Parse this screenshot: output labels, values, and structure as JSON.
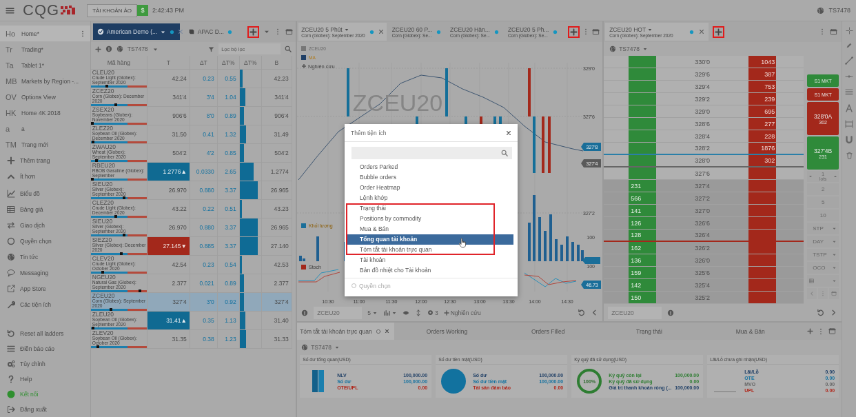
{
  "top_bar": {
    "logo": "CQG",
    "account_button": "TÀI KHOẢN ẢO",
    "currency_badge": "$",
    "time": "2:42:43 PM",
    "account": "TS7478"
  },
  "sidebar": {
    "pages": [
      {
        "abbr": "Ho",
        "label": "Home*",
        "selected": true
      },
      {
        "abbr": "Tr",
        "label": "Trading*",
        "selected": false
      },
      {
        "abbr": "Ta",
        "label": "Tablet 1*",
        "selected": false
      },
      {
        "abbr": "MB",
        "label": "Markets by Region -...",
        "selected": false
      },
      {
        "abbr": "OV",
        "label": "Options View",
        "selected": false
      },
      {
        "abbr": "HK",
        "label": "Home 4K 2018",
        "selected": false
      },
      {
        "abbr": "a",
        "label": "a",
        "selected": false
      },
      {
        "abbr": "TM",
        "label": "Trang mới",
        "selected": false
      }
    ],
    "page_actions": [
      {
        "kind": "plus",
        "label": "Thêm trang"
      },
      {
        "kind": "chevron",
        "label": "Ít hơn"
      }
    ],
    "nav": [
      {
        "kind": "chart",
        "label": "Biểu đồ"
      },
      {
        "kind": "table",
        "label": "Bảng giá"
      },
      {
        "kind": "swap",
        "label": "Giao dịch"
      },
      {
        "kind": "ring",
        "label": "Quyền chọn"
      },
      {
        "kind": "globe",
        "label": "Tin tức"
      },
      {
        "kind": "speech",
        "label": "Messaging"
      },
      {
        "kind": "external",
        "label": "App Store"
      },
      {
        "kind": "wrench",
        "label": "Các tiện ích"
      }
    ],
    "footer": [
      {
        "kind": "reset",
        "label": "Reset all ladders"
      },
      {
        "kind": "list",
        "label": "Điền báo cáo"
      },
      {
        "kind": "gears",
        "label": "Tùy chỉnh"
      },
      {
        "kind": "help",
        "label": "Help"
      },
      {
        "kind": "status",
        "label": "Kết nối",
        "connected": true
      },
      {
        "kind": "logout",
        "label": "Đăng xuất"
      }
    ]
  },
  "quote_panel": {
    "tabs": [
      {
        "label": "American Demo (...",
        "selected": true
      },
      {
        "label": "APAC D...",
        "selected": false
      }
    ],
    "account": "TS7478",
    "filter_placeholder": "Lọc bộ lọc",
    "columns": [
      "Mã hàng",
      "T",
      "ΔT",
      "ΔT%",
      "ΔT%",
      "B"
    ],
    "rows": [
      {
        "symbol": "CLEU20",
        "description": "Crude Light (Globex): September 2020",
        "range": {
          "level": 0.28
        },
        "last": "42.24",
        "kind": "plain",
        "change": "0.23",
        "change_pct": "0.55",
        "level": 0.12,
        "bid": "42.23",
        "selected": false
      },
      {
        "symbol": "ZCEZ20",
        "description": "Corn (Globex): December 2020",
        "range": {
          "level": 0.45
        },
        "last": "341'4",
        "kind": "plain",
        "change": "3'4",
        "change_pct": "1.04",
        "level": 0.25,
        "bid": "341'4",
        "selected": false
      },
      {
        "symbol": "ZSEX20",
        "description": "Soybeans (Globex): November 2020",
        "range": {
          "level": 0.0
        },
        "last": "906'6",
        "kind": "plain",
        "change": "8'0",
        "change_pct": "0.89",
        "level": 0.2,
        "bid": "906'4",
        "selected": false
      },
      {
        "symbol": "ZLEZ20",
        "description": "Soybean Oil (Globex): December 2020",
        "range": {
          "level": 0.02
        },
        "last": "31.50",
        "kind": "plain",
        "change": "0.41",
        "change_pct": "1.32",
        "level": 0.3,
        "bid": "31.49",
        "selected": false
      },
      {
        "symbol": "ZWAU20",
        "description": "Wheat (Globex): September 2020",
        "range": {
          "level": 0.08
        },
        "last": "504'2",
        "kind": "plain",
        "change": "4'2",
        "change_pct": "0.85",
        "level": 0.2,
        "bid": "504'2",
        "selected": false
      },
      {
        "symbol": "RBEU20",
        "description": "RBOB Gasoline (Globex): September",
        "range": {
          "level": 0.0
        },
        "last": "1.2776▲",
        "kind": "up",
        "change": "0.0330",
        "change_pct": "2.65",
        "level": 0.65,
        "bid": "1.2774",
        "selected": false
      },
      {
        "symbol": "SIEU20",
        "description": "Silver (Globex): September 2020",
        "range": {
          "level": 0.6
        },
        "last": "26.970",
        "kind": "plain",
        "change": "0.880",
        "change_pct": "3.37",
        "level": 0.85,
        "bid": "26.965",
        "selected": false
      },
      {
        "symbol": "CLEZ20",
        "description": "Crude Light (Globex): December 2020",
        "range": {
          "level": 0.45
        },
        "last": "43.22",
        "kind": "plain",
        "change": "0.22",
        "change_pct": "0.51",
        "level": 0.1,
        "bid": "43.23",
        "selected": false
      },
      {
        "symbol": "SIEU20",
        "description": "Silver (Globex): September 2020",
        "range": {
          "level": 0.6
        },
        "last": "26.970",
        "kind": "plain",
        "change": "0.880",
        "change_pct": "3.37",
        "level": 0.85,
        "bid": "26.965",
        "selected": false
      },
      {
        "symbol": "SIEZ20",
        "description": "Silver (Globex): December 2020",
        "range": {
          "level": 0.55
        },
        "last": "27.145▼",
        "kind": "down",
        "change": "0.885",
        "change_pct": "3.37",
        "level": 0.85,
        "bid": "27.140",
        "selected": false
      },
      {
        "symbol": "CLEV20",
        "description": "Crude Light (Globex): October 2020",
        "range": {
          "level": 0.2
        },
        "last": "42.54",
        "kind": "plain",
        "change": "0.23",
        "change_pct": "0.54",
        "level": 0.1,
        "bid": "42.53",
        "selected": false
      },
      {
        "symbol": "NGEU20",
        "description": "Natural Gas (Globex): September 2020",
        "range": {
          "level": 0.9
        },
        "last": "2.377",
        "kind": "plain",
        "change": "0.021",
        "change_pct": "0.89",
        "level": 0.2,
        "bid": "2.377",
        "selected": false
      },
      {
        "symbol": "ZCEU20",
        "description": "Corn (Globex): September 2020",
        "range": {
          "level": 0.35
        },
        "last": "327'4",
        "kind": "plain",
        "change": "3'0",
        "change_pct": "0.92",
        "level": 0.2,
        "bid": "327'4",
        "selected": true
      },
      {
        "symbol": "ZLEU20",
        "description": "Soybean Oil (Globex): September 2020",
        "range": {
          "level": 0.02
        },
        "last": "31.41▲",
        "kind": "up",
        "change": "0.35",
        "change_pct": "1.13",
        "level": 0.25,
        "bid": "31.40",
        "selected": false
      },
      {
        "symbol": "ZLEV20",
        "description": "Soybean Oil (Globex): October 2020",
        "range": {
          "level": 0.1
        },
        "last": "31.35",
        "kind": "plain",
        "change": "0.38",
        "change_pct": "1.23",
        "level": 0.28,
        "bid": "31.33",
        "selected": false
      }
    ]
  },
  "chart_panel": {
    "tabs": [
      {
        "title": "ZCEU20 5 Phút",
        "subtitle": "Corn (Globex): September 2020",
        "selected": true
      },
      {
        "title": "ZCEU20 60 P...",
        "subtitle": "Corn (Globex): Se...",
        "selected": false
      },
      {
        "title": "ZCEU20 Hàn...",
        "subtitle": "Corn (Globex): Se...",
        "selected": false
      },
      {
        "title": "ZCEU20 5 Ph...",
        "subtitle": "Corn (Globex): Se...",
        "selected": false
      }
    ],
    "watermark": "ZCEU20",
    "legend": [
      {
        "label": "ZCEU20",
        "color": "#777777"
      },
      {
        "label": "MA",
        "color": "#1f3f66"
      }
    ],
    "study_link": "Nghiên cứu",
    "price_labels": [
      "329'0",
      "327'6",
      "327'2"
    ],
    "price_badges": [
      {
        "text": "327'8",
        "color": "#1a6e99"
      },
      {
        "text": "327'4",
        "color": "#5a5a5a"
      }
    ],
    "volume_legend": {
      "label": "Khối lượng",
      "color": "#1a6e99"
    },
    "volume_label": "100",
    "stoch_legend": {
      "label": "Stoch",
      "color": "#a3281b"
    },
    "stoch_label": "100",
    "stoch_badge": "46.73",
    "time_labels": [
      "10:30",
      "11:00",
      "11:30",
      "12:00",
      "12:30",
      "13:00",
      "13:30",
      "14:00",
      "14:30"
    ],
    "toolbar": {
      "symbol": "ZCEU20",
      "interval": "5",
      "study_count": "3",
      "study_button": "Nghiên cứu"
    }
  },
  "dom_panel": {
    "tab": {
      "title": "ZCEU20 HOT",
      "subtitle": "Corn (Globex): September 2020",
      "selected": true
    },
    "account": "TS7478",
    "ladder": [
      {
        "price": "330'0",
        "ask": "1043",
        "shaded": false
      },
      {
        "price": "329'6",
        "ask": "387",
        "shaded": false
      },
      {
        "price": "329'4",
        "ask": "753",
        "shaded": false
      },
      {
        "price": "329'2",
        "ask": "239",
        "shaded": false
      },
      {
        "price": "329'0",
        "ask": "695",
        "shaded": false
      },
      {
        "price": "328'6",
        "ask": "277",
        "shaded": false
      },
      {
        "price": "328'4",
        "ask": "228",
        "shaded": false
      },
      {
        "price": "328'2",
        "ask": "1876",
        "shaded": false,
        "divider": {
          "color": "#2a7fa8"
        }
      },
      {
        "price": "328'0",
        "ask": "302",
        "shaded": false,
        "divider": {
          "color": "#666666"
        }
      },
      {
        "price": "327'6",
        "shaded": false
      },
      {
        "price": "327'4",
        "bid": "231",
        "shaded": true
      },
      {
        "price": "327'2",
        "bid": "566",
        "shaded": true
      },
      {
        "price": "327'0",
        "bid": "141",
        "shaded": true
      },
      {
        "price": "326'6",
        "bid": "126",
        "shaded": true
      },
      {
        "price": "326'4",
        "bid": "128",
        "shaded": true,
        "divider": {
          "color": "#a3281b"
        }
      },
      {
        "price": "326'2",
        "bid": "162",
        "shaded": true
      },
      {
        "price": "326'0",
        "bid": "136",
        "shaded": true
      },
      {
        "price": "325'6",
        "bid": "159",
        "shaded": true
      },
      {
        "price": "325'4",
        "bid": "142",
        "shaded": true
      },
      {
        "price": "325'2",
        "bid": "150",
        "shaded": true
      }
    ],
    "order_buttons": [
      {
        "label": "S1 MKT",
        "color": "#2f8a3a",
        "kind": "small"
      },
      {
        "label": "S1 MKT",
        "color": "#a3281b",
        "kind": "small"
      },
      {
        "label": "328'0A",
        "sub": "302",
        "color": "#a3281b",
        "kind": "large"
      },
      {
        "label": "327'4B",
        "sub": "231",
        "color": "#2f8a3a",
        "kind": "large"
      }
    ],
    "quantity": {
      "value": "1",
      "unit": "lots"
    },
    "quick_quantities": [
      "2",
      "5",
      "10"
    ],
    "order_types": [
      "STP",
      "DAY",
      "TSTP",
      "OCO"
    ],
    "symbol": "ZCEU20"
  },
  "account_panel": {
    "tabs": [
      {
        "label": "Tóm tắt tài khoản trực quan",
        "selected": true
      },
      {
        "label": "Orders Working",
        "selected": false
      },
      {
        "label": "Orders Filled",
        "selected": false
      },
      {
        "label": "Trạng thái",
        "selected": false
      },
      {
        "label": "Mua & Bán",
        "selected": false
      }
    ],
    "account": "TS7478",
    "cards": [
      {
        "title": "Số dư tổng quan(USD)",
        "kind": "bars",
        "metrics": [
          {
            "label": "NLV",
            "value": "100,000.00",
            "color": "#1f3f66"
          },
          {
            "label": "Số dư",
            "value": "100,000.00",
            "color": "#1572a0"
          },
          {
            "label": "OTE/UPL",
            "value": "0.00",
            "color": "#b0261a"
          }
        ]
      },
      {
        "title": "Số dư tiền mặt(USD)",
        "kind": "pie",
        "metrics": [
          {
            "label": "Số dư",
            "value": "100,000.00",
            "color": "#1f3f66"
          },
          {
            "label": "Số dư tiền mặt",
            "value": "100,000.00",
            "color": "#1572a0"
          },
          {
            "label": "Tài sản đảm bảo",
            "value": "0.00",
            "color": "#b0261a"
          }
        ]
      },
      {
        "title": "Ký quỹ đã sử dụng(USD)",
        "kind": "ring",
        "ring_label": "100%",
        "metrics": [
          {
            "label": "Ký quỹ còn lại",
            "value": "100,000.00",
            "color": "#2e7d32"
          },
          {
            "label": "Ký quỹ đã sử dụng",
            "value": "0.00",
            "color": "#2e7d32"
          },
          {
            "label": "Giá trị thanh khoản ròng (...",
            "value": "100,000.00",
            "color": "#1f3f66"
          }
        ]
      },
      {
        "title": "Lãi/Lỗ chưa ghi nhận(USD)",
        "kind": "line",
        "metrics": [
          {
            "label": "Lãi/Lỗ",
            "value": "0.00",
            "color": "#1f3f66"
          },
          {
            "label": "OTE",
            "value": "0.00",
            "color": "#1572a0"
          },
          {
            "label": "MVO",
            "value": "0.00",
            "color": "#666666"
          },
          {
            "label": "UPL",
            "value": "0.00",
            "color": "#b0261a"
          }
        ]
      }
    ]
  },
  "dialog": {
    "title": "Thêm tiện ích",
    "items": [
      {
        "label": "Orders Parked",
        "selected": false,
        "highlighted": false
      },
      {
        "label": "Bubble orders",
        "selected": false,
        "highlighted": false
      },
      {
        "label": "Order Heatmap",
        "selected": false,
        "highlighted": false
      },
      {
        "label": "Lệnh khớp",
        "selected": false,
        "highlighted": false
      },
      {
        "label": "Trạng thái",
        "selected": false,
        "highlighted": true
      },
      {
        "label": "Positions by commodity",
        "selected": false,
        "highlighted": true
      },
      {
        "label": "Mua & Bán",
        "selected": false,
        "highlighted": true
      },
      {
        "label": "Tổng quan tài khoản",
        "selected": true,
        "highlighted": true
      },
      {
        "label": "Tóm tắt tài khoản trực quan",
        "selected": false,
        "highlighted": true
      },
      {
        "label": "Tài khoản",
        "selected": false,
        "highlighted": false
      },
      {
        "label": "Bản đồ nhiệt cho Tài khoản",
        "selected": false,
        "highlighted": false
      }
    ],
    "section": "Quyền chọn"
  },
  "plus_buttons": [
    {
      "highlighted": true
    },
    {
      "highlighted": true
    },
    {
      "highlighted": true
    }
  ]
}
